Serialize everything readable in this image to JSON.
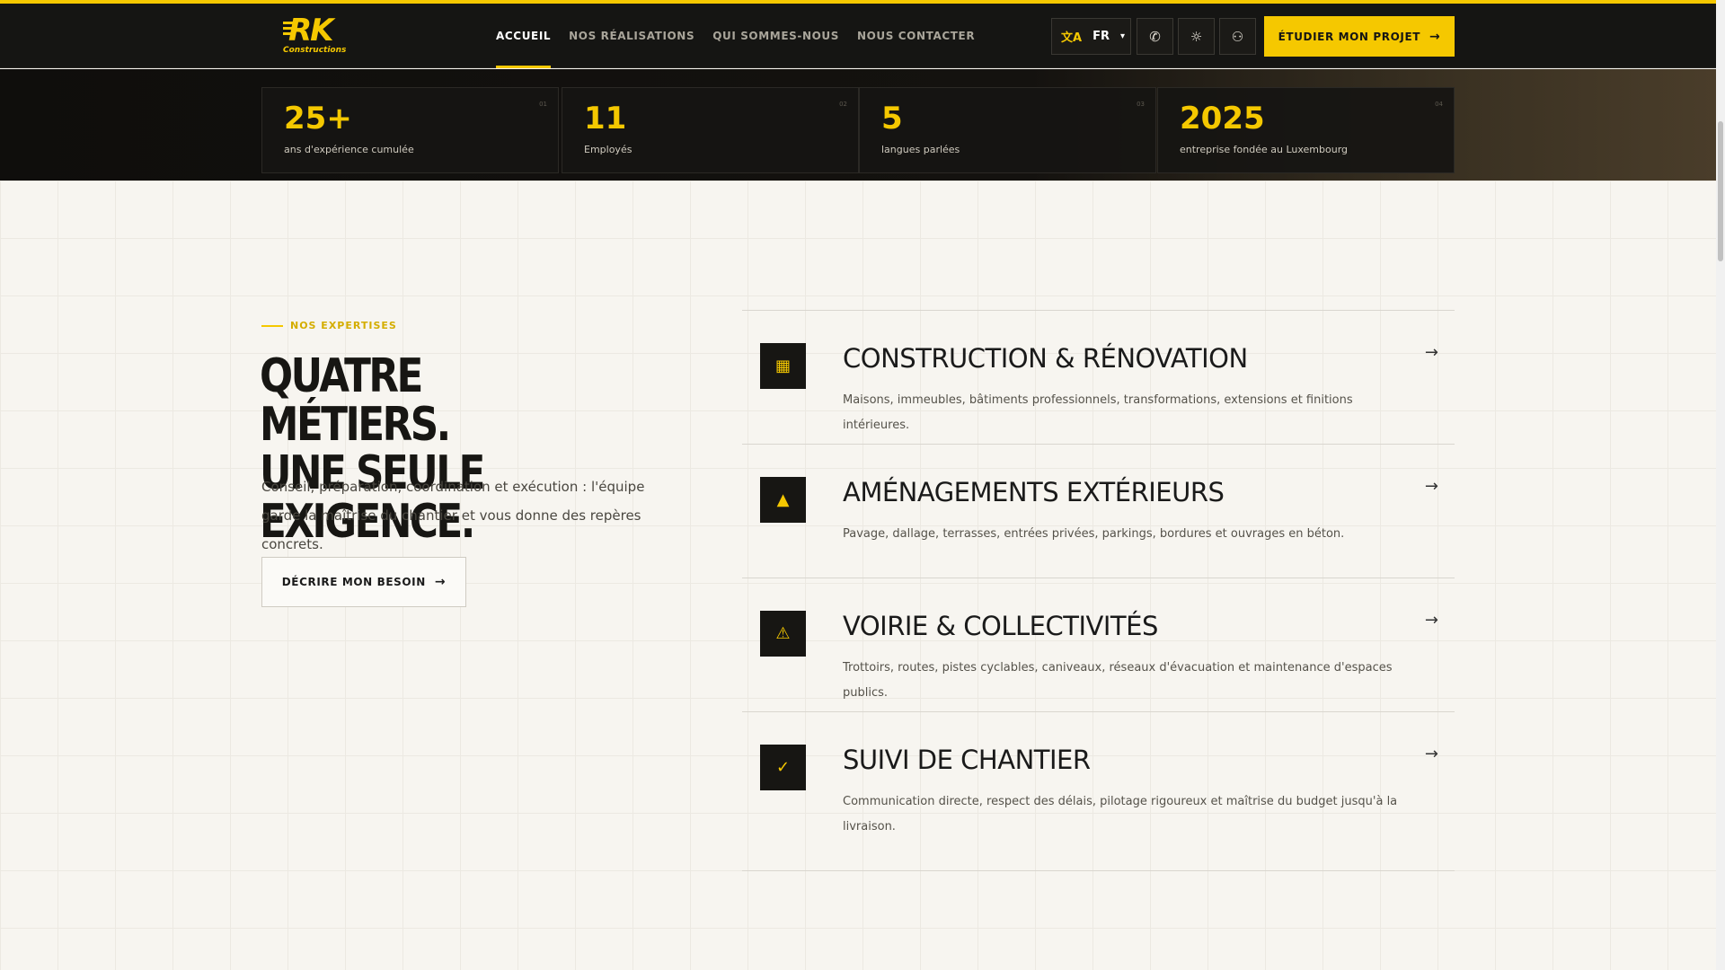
{
  "brand": {
    "logo_text": "RK",
    "logo_subtext": "Constructions",
    "accent_color": "#f5c800",
    "dark_color": "#151513"
  },
  "nav": {
    "items": [
      {
        "label": "ACCUEIL",
        "active": true
      },
      {
        "label": "NOS RÉALISATIONS",
        "active": false
      },
      {
        "label": "QUI SOMMES-NOUS",
        "active": false
      },
      {
        "label": "NOUS CONTACTER",
        "active": false
      }
    ]
  },
  "header_tools": {
    "language": "FR",
    "language_icon": "translate-icon",
    "phone_icon": "phone-icon",
    "theme_icon": "sun-icon",
    "account_icon": "user-icon",
    "cta_label": "ÉTUDIER MON PROJET"
  },
  "stats": [
    {
      "index": "01",
      "value": "25+",
      "label": "ans d'expérience cumulée"
    },
    {
      "index": "02",
      "value": "11",
      "label": "Employés"
    },
    {
      "index": "03",
      "value": "5",
      "label": "langues parlées"
    },
    {
      "index": "04",
      "value": "2025",
      "label": "entreprise fondée au Luxembourg"
    }
  ],
  "expertise": {
    "eyebrow": "NOS EXPERTISES",
    "headline_line1": "QUATRE MÉTIERS.",
    "headline_line2": "UNE SEULE EXIGENCE.",
    "intro": "Conseil, préparation, coordination et exécution : l'équipe garde la maîtrise du chantier et vous donne des repères concrets.",
    "button_label": "DÉCRIRE MON BESOIN"
  },
  "services": [
    {
      "icon": "building-icon",
      "title": "CONSTRUCTION & RÉNOVATION",
      "description": "Maisons, immeubles, bâtiments professionnels, transformations, extensions et finitions intérieures."
    },
    {
      "icon": "tree-icon",
      "title": "AMÉNAGEMENTS EXTÉRIEURS",
      "description": "Pavage, dallage, terrasses, entrées privées, parkings, bordures et ouvrages en béton."
    },
    {
      "icon": "warning-icon",
      "title": "VOIRIE & COLLECTIVITÉS",
      "description": "Trottoirs, routes, pistes cyclables, caniveaux, réseaux d'évacuation et maintenance d'espaces publics."
    },
    {
      "icon": "shield-check-icon",
      "title": "SUIVI DE CHANTIER",
      "description": "Communication directe, respect des délais, pilotage rigoureux et maîtrise du budget jusqu'à la livraison."
    }
  ]
}
